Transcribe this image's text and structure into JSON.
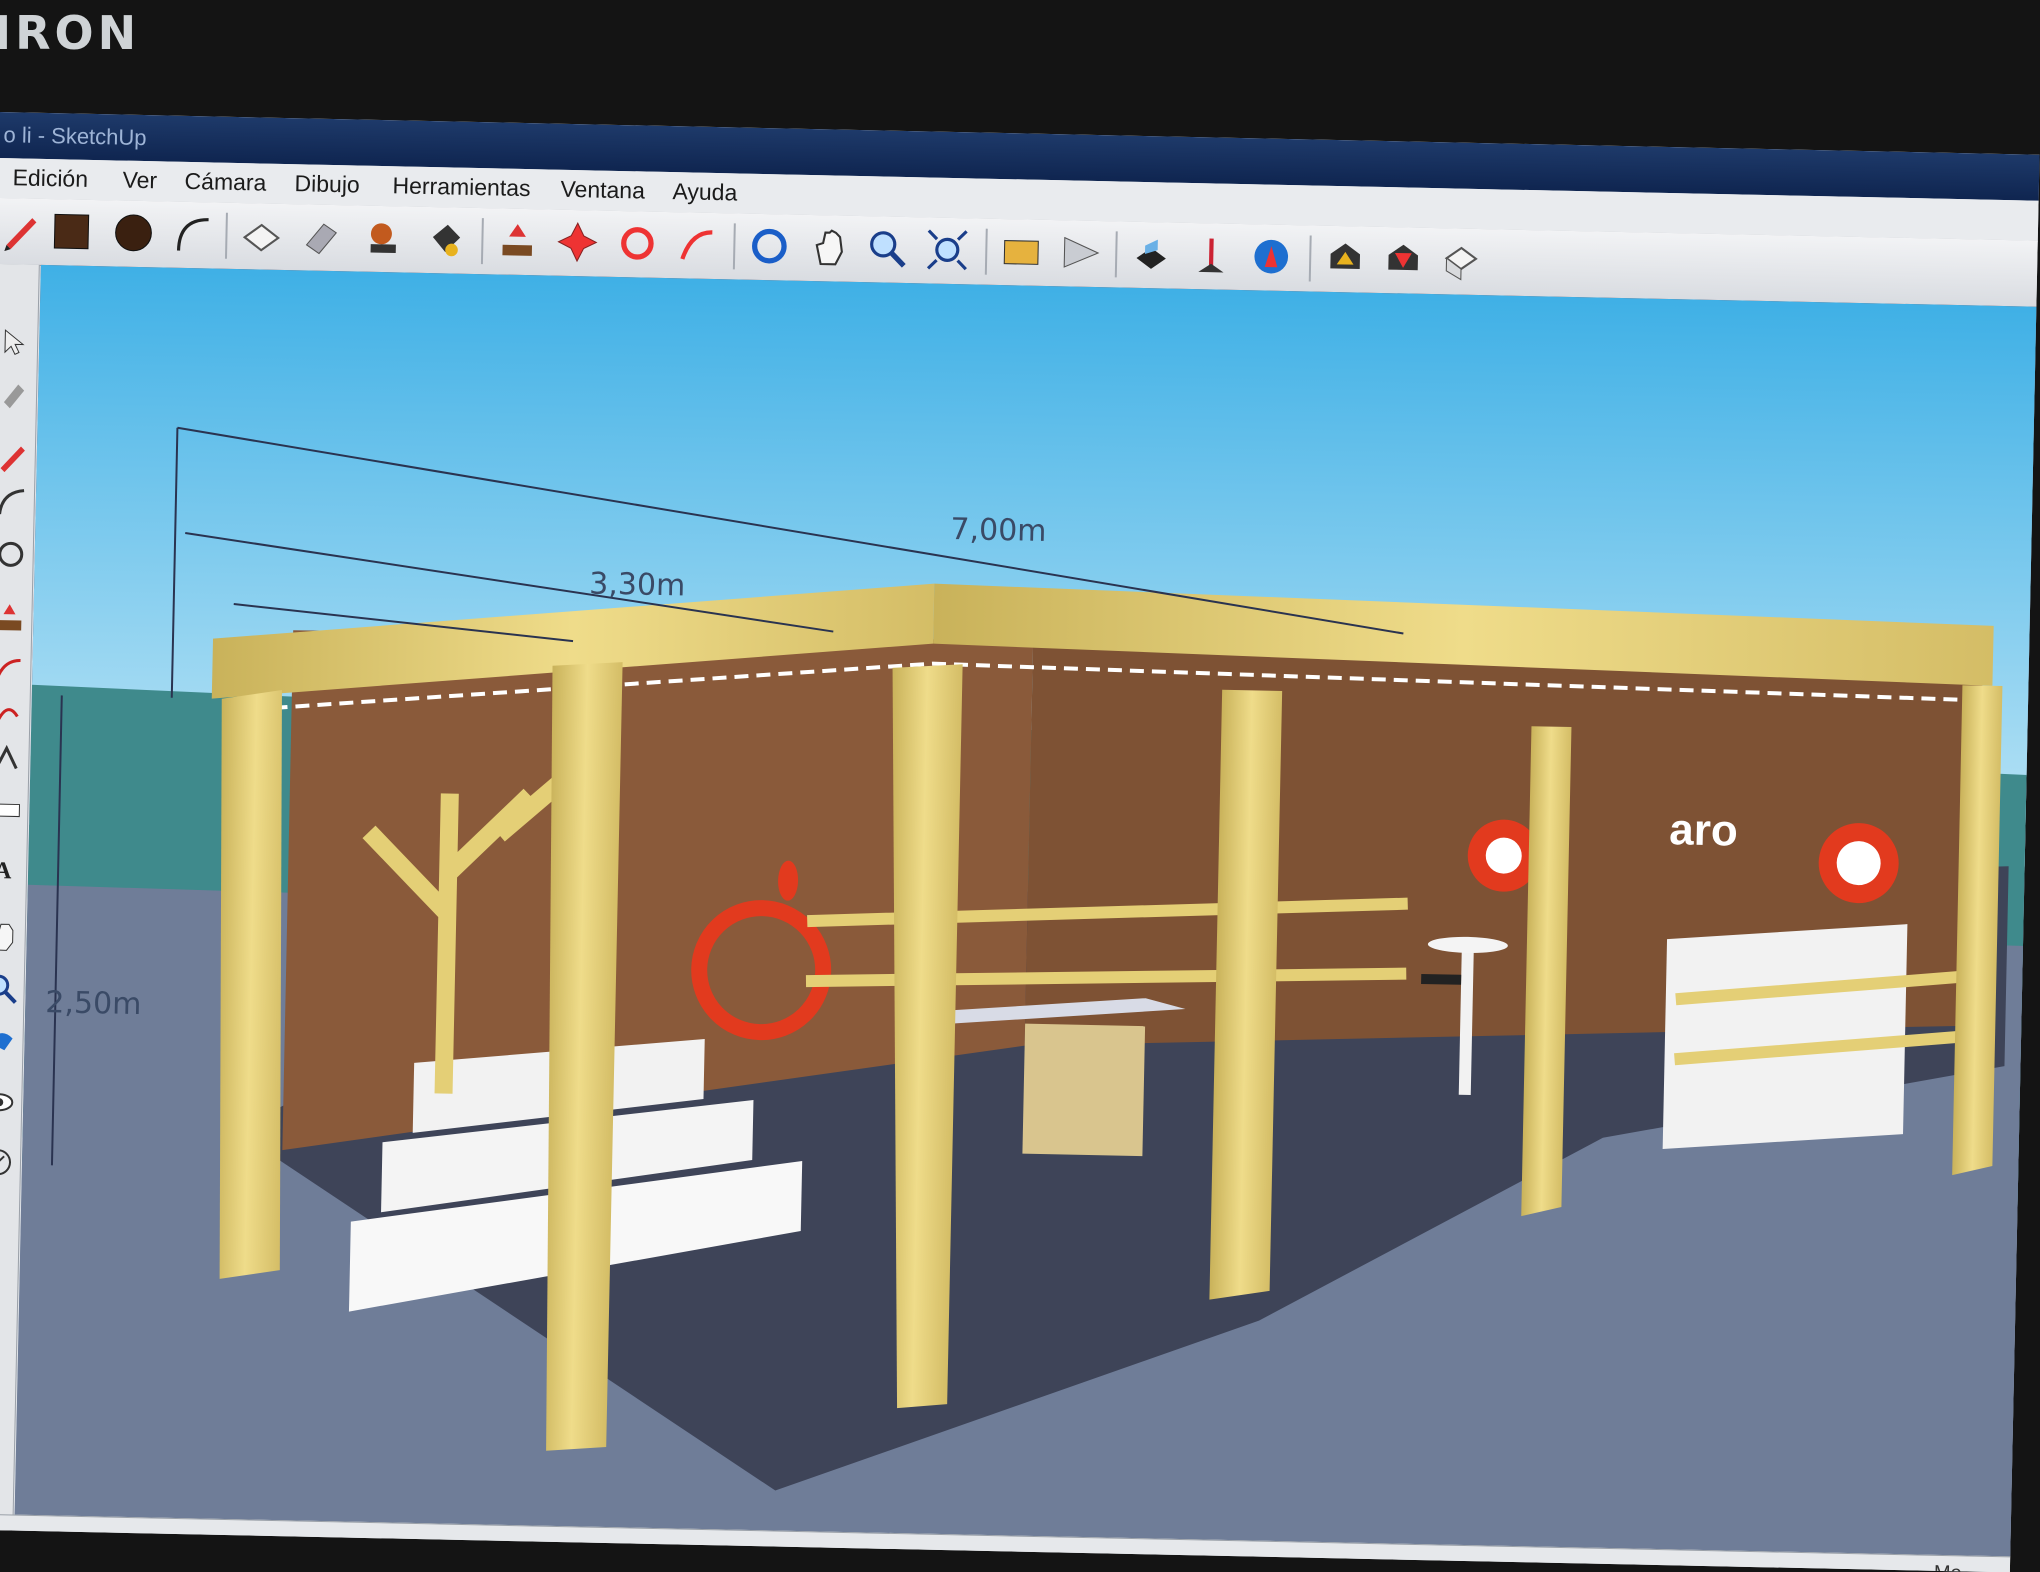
{
  "bezel": {
    "brand": "IRON"
  },
  "window": {
    "title": "o li - SketchUp"
  },
  "menu": [
    "Edición",
    "Ver",
    "Cámara",
    "Dibujo",
    "Herramientas",
    "Ventana",
    "Ayuda"
  ],
  "toolbar": {
    "icons": [
      "pencil-icon",
      "rectangle-icon",
      "circle-icon",
      "arc-icon",
      "make-component-icon",
      "eraser-icon",
      "tape-measure-icon",
      "paint-bucket-icon",
      "push-pull-icon",
      "move-icon",
      "rotate-icon",
      "follow-me-icon",
      "orbit-icon",
      "pan-icon",
      "zoom-icon",
      "zoom-extents-icon",
      "get-models-icon",
      "share-model-icon",
      "component-icon",
      "position-camera-icon",
      "google-earth-icon",
      "previous-view-icon",
      "next-view-icon",
      "standard-views-icon"
    ]
  },
  "sidebar": {
    "icons": [
      "select-icon",
      "paint-icon",
      "pencil-icon",
      "arc-icon",
      "circle-icon",
      "push-pull-icon",
      "follow-me-icon",
      "rotate-icon",
      "offset-icon",
      "dimension-icon",
      "text-icon",
      "pan-icon",
      "zoom-icon",
      "zoom-window-icon",
      "look-around-icon",
      "walk-icon"
    ]
  },
  "model": {
    "dimensions": {
      "total_width": "7,00m",
      "module_width": "3,30m",
      "height": "2,50m"
    },
    "brand_text": "aro",
    "colors": {
      "sky_top": "#3fb0e6",
      "sky_bottom": "#bfe6f6",
      "ground": "#3f8a8c",
      "floor": "#3e4458",
      "timber": "#e4cf76",
      "wall": "#8a5a3a",
      "logo_red": "#e23a1e"
    }
  },
  "statusbar": {
    "measure": "Me"
  }
}
